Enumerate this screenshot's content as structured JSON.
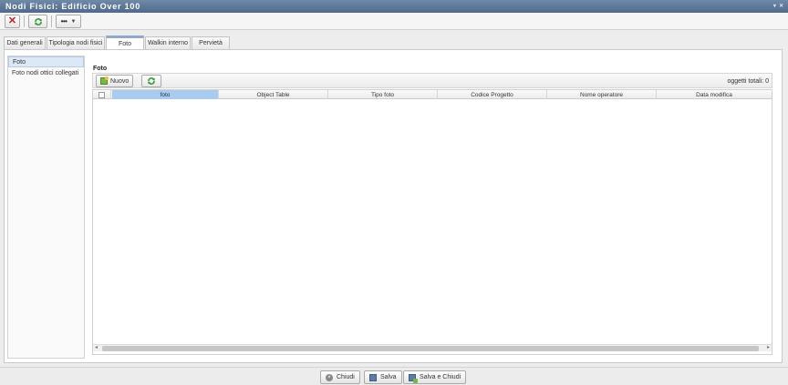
{
  "window": {
    "title": "Nodi Fisici: Edificio Over 100"
  },
  "toolbar": {
    "close_icon": "x-icon",
    "refresh_icon": "refresh-icon",
    "more_icon": "more-icon"
  },
  "tabs": [
    {
      "label": "Dati generali",
      "active": false
    },
    {
      "label": "Tipologia nodi fisici",
      "active": false
    },
    {
      "label": "Foto",
      "active": true
    },
    {
      "label": "Walkin interno",
      "active": false
    },
    {
      "label": "Pervietà",
      "active": false
    }
  ],
  "subnav": [
    {
      "label": "Foto",
      "active": true
    },
    {
      "label": "Foto nodi ottici collegati",
      "active": false
    }
  ],
  "section": {
    "title": "Foto",
    "new_label": "Nuovo",
    "total_label": "oggetti totali: 0"
  },
  "grid": {
    "columns": [
      "foto",
      "Object Table",
      "Tipo foto",
      "Codice Progetto",
      "Nome operatore",
      "Data modifica"
    ],
    "rows": []
  },
  "footer": {
    "close_label": "Chiudi",
    "save_label": "Salva",
    "save_close_label": "Salva e Chiudi"
  },
  "colors": {
    "titlebar": "#5f7a9b",
    "selected_col": "#a8cbef",
    "active_tab": "#8fa9c6"
  }
}
